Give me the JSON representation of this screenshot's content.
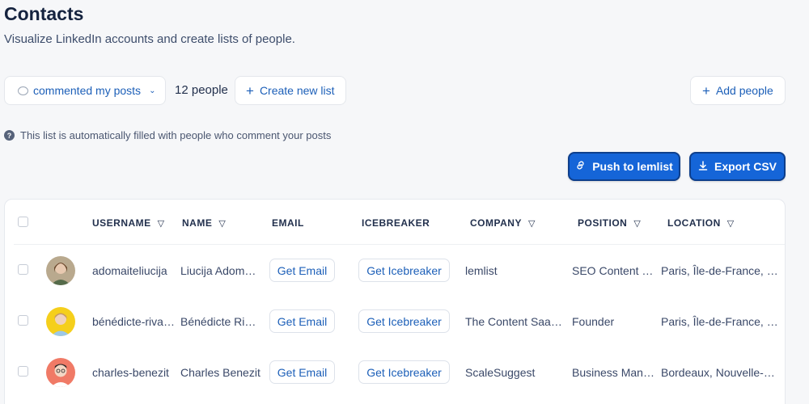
{
  "header": {
    "title": "Contacts",
    "subtitle": "Visualize LinkedIn accounts and create lists of people."
  },
  "toolbar": {
    "filter_label": "commented my posts",
    "people_count": "12 people",
    "create_list_label": "Create new list",
    "add_people_label": "Add people"
  },
  "info_text": "This list is automatically filled with people who comment your posts",
  "actions": {
    "push_label": "Push to lemlist",
    "export_label": "Export CSV",
    "accent_color": "#1565d8"
  },
  "table": {
    "columns": [
      "USERNAME",
      "NAME",
      "EMAIL",
      "ICEBREAKER",
      "COMPANY",
      "POSITION",
      "LOCATION"
    ],
    "rows": [
      {
        "username": "adomaiteliucija",
        "name": "Liucija Adomaitė",
        "email_button": "Get Email",
        "icebreaker_button": "Get Icebreaker",
        "company": "lemlist",
        "position": "SEO Content Writer",
        "location": "Paris, Île-de-France, France"
      },
      {
        "username": "bénédicte-rivalain",
        "name": "Bénédicte Rivalain",
        "email_button": "Get Email",
        "icebreaker_button": "Get Icebreaker",
        "company": "The Content SaaStory",
        "position": "Founder",
        "location": "Paris, Île-de-France, France"
      },
      {
        "username": "charles-benezit",
        "name": "Charles Benezit",
        "email_button": "Get Email",
        "icebreaker_button": "Get Icebreaker",
        "company": "ScaleSuggest",
        "position": "Business Manager",
        "location": "Bordeaux, Nouvelle-Aquitaine, France"
      }
    ]
  }
}
